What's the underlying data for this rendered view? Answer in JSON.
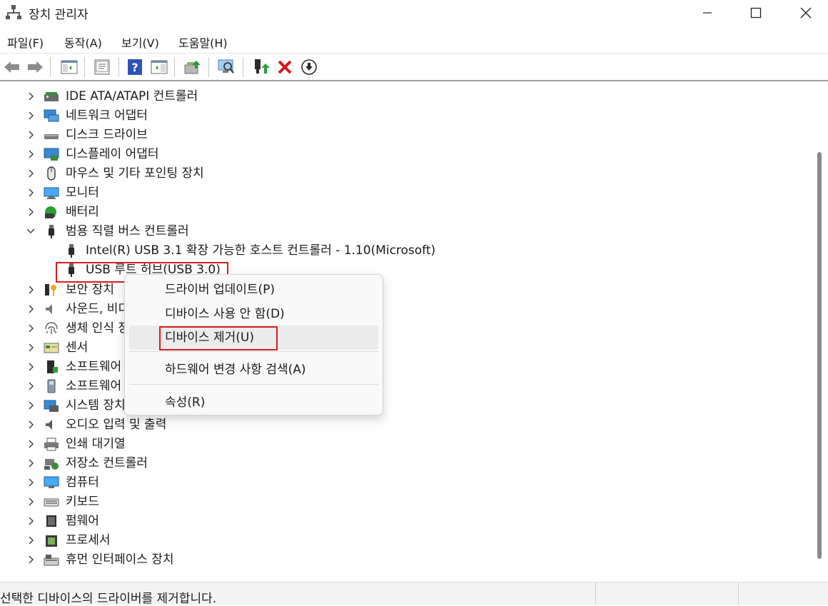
{
  "window": {
    "title": "장치 관리자",
    "controls": {
      "minimize": "─",
      "maximize": "☐",
      "close": "✕"
    }
  },
  "menu": [
    "파일(F)",
    "동작(A)",
    "보기(V)",
    "도움말(H)"
  ],
  "toolbar": [
    {
      "name": "back-icon"
    },
    {
      "name": "forward-icon"
    },
    {
      "name": "show-hide-console-tree-icon"
    },
    {
      "name": "properties-icon"
    },
    {
      "name": "help-icon"
    },
    {
      "name": "show-action-pane-icon"
    },
    {
      "name": "update-driver-icon"
    },
    {
      "name": "scan-hardware-icon"
    },
    {
      "name": "enable-device-icon"
    },
    {
      "name": "uninstall-device-icon"
    },
    {
      "name": "download-icon"
    }
  ],
  "tree": {
    "items": [
      {
        "label": "IDE ATA/ATAPI 컨트롤러",
        "icon": "ide-controller-icon",
        "expanded": false
      },
      {
        "label": "네트워크 어댑터",
        "icon": "network-adapter-icon",
        "expanded": false
      },
      {
        "label": "디스크 드라이브",
        "icon": "disk-drive-icon",
        "expanded": false
      },
      {
        "label": "디스플레이 어댑터",
        "icon": "display-adapter-icon",
        "expanded": false
      },
      {
        "label": "마우스 및 기타 포인팅 장치",
        "icon": "mouse-icon",
        "expanded": false
      },
      {
        "label": "모니터",
        "icon": "monitor-icon",
        "expanded": false
      },
      {
        "label": "배터리",
        "icon": "battery-icon",
        "expanded": false
      },
      {
        "label": "범용 직렬 버스 컨트롤러",
        "icon": "usb-icon",
        "expanded": true
      },
      {
        "label": "Intel(R) USB 3.1 확장 가능한 호스트 컨트롤러 - 1.10(Microsoft)",
        "icon": "usb-icon",
        "child": true
      },
      {
        "label": "USB 루트 허브(USB 3.0)",
        "icon": "usb-icon",
        "child": true,
        "selected": true
      },
      {
        "label": "보안 장치",
        "icon": "security-device-icon",
        "expanded": false
      },
      {
        "label": "사운드, 비디오 및 게임 컨트롤러",
        "icon": "sound-icon",
        "expanded": false
      },
      {
        "label": "생체 인식 장치",
        "icon": "biometric-icon",
        "expanded": false
      },
      {
        "label": "센서",
        "icon": "sensor-icon",
        "expanded": false
      },
      {
        "label": "소프트웨어 구성 요소",
        "icon": "software-component-icon",
        "expanded": false
      },
      {
        "label": "소프트웨어 장치",
        "icon": "software-device-icon",
        "expanded": false
      },
      {
        "label": "시스템 장치",
        "icon": "system-device-icon",
        "expanded": false
      },
      {
        "label": "오디오 입력 및 출력",
        "icon": "audio-io-icon",
        "expanded": false
      },
      {
        "label": "인쇄 대기열",
        "icon": "print-queue-icon",
        "expanded": false
      },
      {
        "label": "저장소 컨트롤러",
        "icon": "storage-controller-icon",
        "expanded": false
      },
      {
        "label": "컴퓨터",
        "icon": "computer-icon",
        "expanded": false
      },
      {
        "label": "키보드",
        "icon": "keyboard-icon",
        "expanded": false
      },
      {
        "label": "펌웨어",
        "icon": "firmware-icon",
        "expanded": false
      },
      {
        "label": "프로세서",
        "icon": "processor-icon",
        "expanded": false
      },
      {
        "label": "휴먼 인터페이스 장치",
        "icon": "hid-icon",
        "expanded": false
      }
    ]
  },
  "context_menu": {
    "items": [
      {
        "label": "드라이버 업데이트(P)"
      },
      {
        "label": "디바이스 사용 안 함(D)"
      },
      {
        "label": "디바이스 제거(U)",
        "hover": true
      },
      {
        "label": "하드웨어 변경 사항 검색(A)"
      },
      {
        "label": "속성(R)"
      }
    ]
  },
  "status": {
    "text": "선택한 디바이스의 드라이버를 제거합니다."
  },
  "colors": {
    "highlight": "#d22020",
    "menu_hover": "#ebebeb",
    "accent": "#0067c0"
  }
}
